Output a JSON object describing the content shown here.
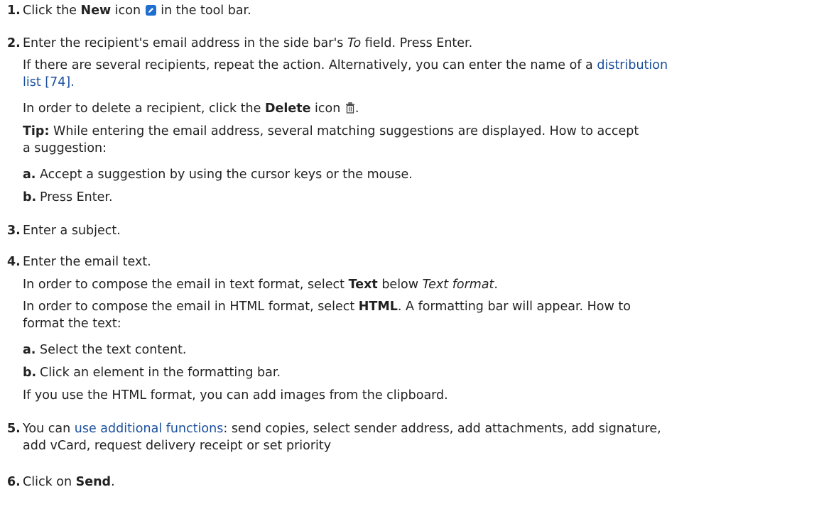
{
  "steps": [
    {
      "num": "1.",
      "pre": "Click the ",
      "bold": "New",
      "mid": " icon ",
      "icon": "pencil-icon",
      "post": " in the tool bar."
    },
    {
      "num": "2.",
      "line1_pre": "Enter the recipient's email address in the side bar's ",
      "line1_ital": "To",
      "line1_post": " field. Press Enter.",
      "line2": "If there are several recipients, repeat the action. Alternatively, you can enter the name of a ",
      "link_part1": "distribution",
      "link_part2": "list [74].",
      "line3_pre": "In order to delete a recipient, click the ",
      "line3_bold": "Delete",
      "line3_post": " icon ",
      "line3_icon": "trash-icon",
      "line3_end": ".",
      "tip_label": "Tip:",
      "tip_text1": " While entering the email address, several matching suggestions are displayed. How to accept",
      "tip_text2": "a suggestion:",
      "sub": [
        {
          "num": "a.",
          "text": "Accept a suggestion by using the cursor keys or the mouse."
        },
        {
          "num": "b.",
          "text": "Press Enter."
        }
      ]
    },
    {
      "num": "3.",
      "text": "Enter a subject."
    },
    {
      "num": "4.",
      "text": "Enter the email text.",
      "line2_pre": "In order to compose the email in text format, select ",
      "line2_bold": "Text",
      "line2_mid": " below ",
      "line2_ital": "Text format",
      "line2_end": ".",
      "line3_pre": "In order to compose the email in HTML format, select ",
      "line3_bold": "HTML",
      "line3_post": ". A formatting bar will appear. How to",
      "line3b": "format the text:",
      "sub": [
        {
          "num": "a.",
          "text": "Select the text content."
        },
        {
          "num": "b.",
          "text": "Click an element in the formatting bar."
        }
      ],
      "line4": "If you use the HTML format, you can add images from the clipboard."
    },
    {
      "num": "5.",
      "pre": "You can ",
      "link": "use additional functions",
      "post": ": send copies, select sender address, add attachments, add signature,",
      "line2": "add vCard, request delivery receipt or set priority"
    },
    {
      "num": "6.",
      "pre": "Click on ",
      "bold": "Send",
      "post": "."
    }
  ]
}
